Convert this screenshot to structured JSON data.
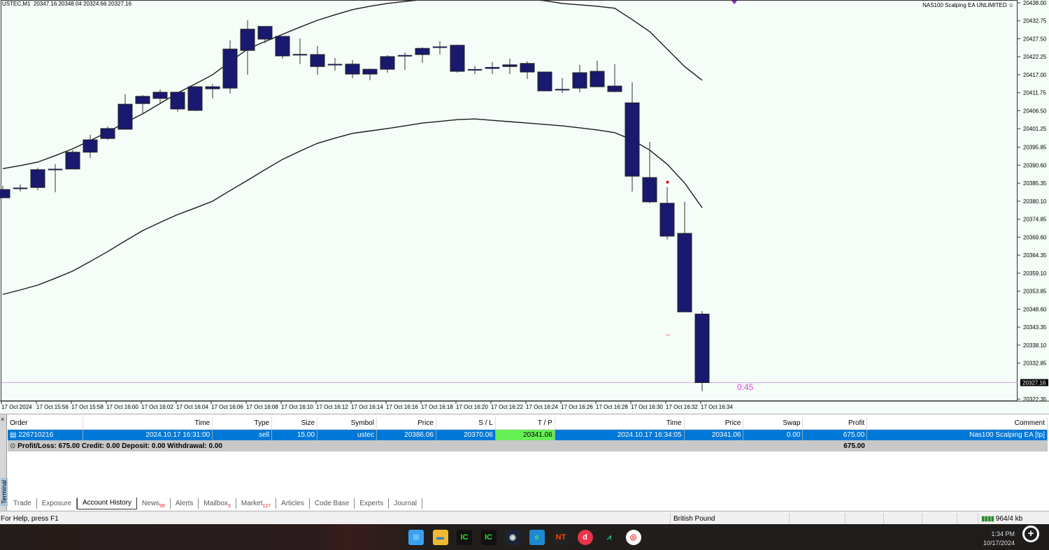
{
  "chart": {
    "header": "USTEC,M1  20347.16 20348.04 20324.66 20327.16",
    "ea_label": "NAS100 Scalping EA UNLIMITED",
    "timer": "0:45",
    "bid": 20327.16,
    "bid_label": "20327.16",
    "colors": {
      "background": "#f4fdf7",
      "candle": "#191970",
      "bid_line": "#c8a8e8",
      "band": "#1a1a1a",
      "timer": "#e040e0"
    }
  },
  "chart_data": {
    "type": "candlestick",
    "symbol": "USTEC",
    "timeframe": "M1",
    "ylim": [
      20322.35,
      20438.0
    ],
    "y_ticks": [
      "20438.00",
      "20432.75",
      "20427.50",
      "20422.25",
      "20417.00",
      "20411.75",
      "20406.50",
      "20401.25",
      "20395.85",
      "20390.60",
      "20385.35",
      "20380.10",
      "20374.85",
      "20369.60",
      "20364.35",
      "20359.10",
      "20353.85",
      "20348.60",
      "20343.35",
      "20338.10",
      "20332.85",
      "20322.35"
    ],
    "x_ticks": [
      "17 Oct 2024",
      "17 Oct 15:56",
      "17 Oct 15:58",
      "17 Oct 16:00",
      "17 Oct 16:02",
      "17 Oct 16:04",
      "17 Oct 16:06",
      "17 Oct 16:08",
      "17 Oct 16:10",
      "17 Oct 16:12",
      "17 Oct 16:14",
      "17 Oct 16:16",
      "17 Oct 16:18",
      "17 Oct 16:20",
      "17 Oct 16:22",
      "17 Oct 16:24",
      "17 Oct 16:26",
      "17 Oct 16:28",
      "17 Oct 16:30",
      "17 Oct 16:32",
      "17 Oct 16:34"
    ],
    "candles": [
      [
        20381.1,
        20384.6,
        20381.1,
        20383.5
      ],
      [
        20383.8,
        20385.0,
        20382.9,
        20384.0
      ],
      [
        20384.1,
        20389.9,
        20383.3,
        20389.3
      ],
      [
        20389.3,
        20390.9,
        20382.7,
        20389.5
      ],
      [
        20389.5,
        20395.0,
        20389.5,
        20394.4
      ],
      [
        20394.4,
        20399.5,
        20392.7,
        20398.0
      ],
      [
        20398.4,
        20401.9,
        20398.0,
        20401.3
      ],
      [
        20401.1,
        20411.3,
        20401.1,
        20408.4
      ],
      [
        20408.6,
        20411.1,
        20405.8,
        20410.7
      ],
      [
        20410.1,
        20412.7,
        20408.6,
        20411.9
      ],
      [
        20411.9,
        20411.9,
        20406.2,
        20407.0
      ],
      [
        20406.6,
        20413.7,
        20406.4,
        20413.5
      ],
      [
        20412.9,
        20414.3,
        20410.1,
        20413.5
      ],
      [
        20413.1,
        20427.0,
        20411.5,
        20424.5
      ],
      [
        20424.1,
        20432.9,
        20417.0,
        20430.3
      ],
      [
        20431.1,
        20431.1,
        20426.2,
        20427.4
      ],
      [
        20428.2,
        20428.2,
        20421.7,
        20422.5
      ],
      [
        20423.0,
        20427.6,
        20420.1,
        20422.9
      ],
      [
        20422.9,
        20425.4,
        20417.0,
        20419.4
      ],
      [
        20420.1,
        20421.9,
        20418.2,
        20420.0
      ],
      [
        20420.1,
        20421.3,
        20416.0,
        20417.2
      ],
      [
        20417.2,
        20418.8,
        20415.4,
        20418.6
      ],
      [
        20418.6,
        20422.7,
        20417.6,
        20422.3
      ],
      [
        20422.6,
        20423.5,
        20418.4,
        20422.7
      ],
      [
        20422.9,
        20425.0,
        20420.5,
        20424.7
      ],
      [
        20425.1,
        20426.8,
        20422.9,
        20425.2
      ],
      [
        20425.6,
        20425.8,
        20417.6,
        20418.0
      ],
      [
        20418.6,
        20419.6,
        20417.2,
        20418.6
      ],
      [
        20418.8,
        20420.7,
        20417.2,
        20419.2
      ],
      [
        20419.4,
        20421.7,
        20417.2,
        20419.9
      ],
      [
        20420.3,
        20420.9,
        20415.8,
        20417.8
      ],
      [
        20417.8,
        20417.8,
        20412.3,
        20412.3
      ],
      [
        20412.8,
        20416.0,
        20411.7,
        20412.7
      ],
      [
        20413.1,
        20419.9,
        20411.9,
        20417.6
      ],
      [
        20418.0,
        20421.1,
        20413.5,
        20413.5
      ],
      [
        20413.7,
        20420.1,
        20411.9,
        20412.1
      ],
      [
        20408.8,
        20414.8,
        20382.9,
        20387.4
      ],
      [
        20387.0,
        20397.4,
        20379.5,
        20379.9
      ],
      [
        20379.5,
        20384.2,
        20368.9,
        20369.9
      ],
      [
        20370.7,
        20379.9,
        20347.8,
        20347.8
      ],
      [
        20347.16,
        20348.04,
        20324.66,
        20327.16
      ]
    ],
    "bands": {
      "upper": [
        20389.6,
        20390.5,
        20391.5,
        20393.4,
        20395.4,
        20397.8,
        20400.3,
        20403.0,
        20405.6,
        20408.6,
        20411.7,
        20414.3,
        20417.0,
        20420.8,
        20424.5,
        20426.7,
        20428.8,
        20430.9,
        20432.9,
        20434.5,
        20436.0,
        20437.0,
        20437.8,
        20438.4,
        20438.9,
        20439.4,
        20439.7,
        20439.9,
        20439.8,
        20439.5,
        20439.1,
        20438.6,
        20437.8,
        20437.4,
        20437.0,
        20436.4,
        20433.1,
        20429.6,
        20424.5,
        20419.4,
        20415.4
      ],
      "lower": [
        20352.9,
        20354.2,
        20355.6,
        20357.6,
        20359.7,
        20362.5,
        20365.4,
        20368.5,
        20371.5,
        20373.9,
        20376.2,
        20378.1,
        20380.1,
        20383.2,
        20386.2,
        20389.3,
        20392.3,
        20394.7,
        20397.0,
        20398.5,
        20399.9,
        20400.6,
        20401.3,
        20402.1,
        20402.9,
        20403.4,
        20403.9,
        20404.1,
        20403.7,
        20403.3,
        20402.9,
        20402.5,
        20402.1,
        20401.5,
        20400.9,
        20400.1,
        20398.0,
        20395.0,
        20390.9,
        20385.4,
        20378.2
      ]
    },
    "trade_entry": {
      "candle": 38,
      "price": 20386.06
    },
    "trade_tp": {
      "candle": 37,
      "price": 20341.06
    }
  },
  "terminal": {
    "side_label": "Terminal",
    "columns": [
      "Order",
      "Time",
      "Type",
      "Size",
      "Symbol",
      "Price",
      "S / L",
      "T / P",
      "Time",
      "Price",
      "Swap",
      "Profit",
      "Comment"
    ],
    "rows": [
      [
        "226710216",
        "2024.10.17 16:31:00",
        "sell",
        "15.00",
        "ustec",
        "20386.06",
        "20370.06",
        "20341.06",
        "2024.10.17 16:34:05",
        "20341.06",
        "0.00",
        "675.00",
        "Nas100 Scalping EA [tp]"
      ]
    ],
    "summary": "Profit/Loss: 675.00  Credit: 0.00  Deposit: 0.00  Withdrawal: 0.00",
    "summary_profit": "675.00",
    "tabs": [
      {
        "label": "Trade"
      },
      {
        "label": "Exposure"
      },
      {
        "label": "Account History",
        "active": true
      },
      {
        "label": "News",
        "badge": "99"
      },
      {
        "label": "Alerts"
      },
      {
        "label": "Mailbox",
        "badge": "3"
      },
      {
        "label": "Market",
        "badge": "127"
      },
      {
        "label": "Articles"
      },
      {
        "label": "Code Base"
      },
      {
        "label": "Experts"
      },
      {
        "label": "Journal"
      }
    ]
  },
  "status": {
    "help": "For Help, press F1",
    "currency": "British Pound",
    "traffic": "964/4 kb"
  },
  "taskbar": {
    "apps": [
      "start-icon",
      "file-explorer-icon",
      "ic-markets-mt4-icon",
      "ic-markets-mt4-icon",
      "app-owl-icon",
      "edge-icon",
      "nt-icon",
      "d-app-icon",
      "tradingview-icon",
      "chrome-icon"
    ],
    "time": "1:34 PM",
    "date": "10/17/2024"
  }
}
